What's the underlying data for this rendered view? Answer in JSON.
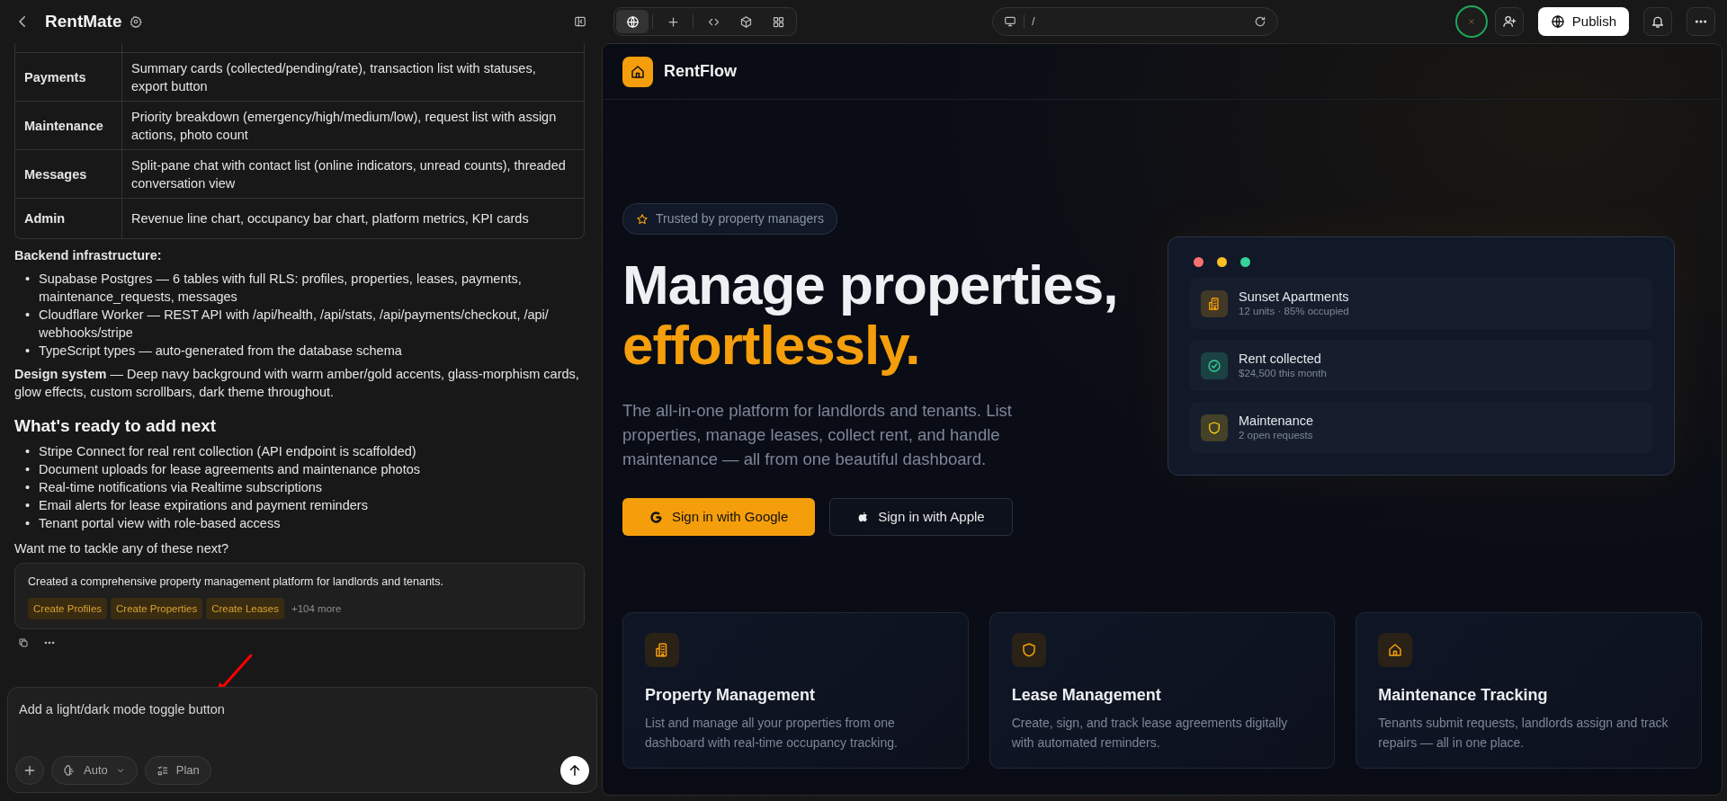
{
  "app": {
    "title": "RentMate"
  },
  "table": {
    "rows": [
      {
        "page": "Payments",
        "description": "Summary cards (collected/pending/rate), transaction list with statuses, export button"
      },
      {
        "page": "Maintenance",
        "description": "Priority breakdown (emergency/high/medium/low), request list with assign actions, photo count"
      },
      {
        "page": "Messages",
        "description": "Split-pane chat with contact list (online indicators, unread counts), threaded conversation view"
      },
      {
        "page": "Admin",
        "description": "Revenue line chart, occupancy bar chart, platform metrics, KPI cards"
      }
    ]
  },
  "bullet": "•",
  "backend": {
    "heading": "Backend infrastructure:",
    "items": [
      "Supabase Postgres — 6 tables with full RLS: profiles, properties, leases, payments, maintenance_requests, messages",
      "Cloudflare Worker — REST API with /api/health, /api/stats, /api/payments/checkout, /api/ webhooks/stripe",
      "TypeScript types — auto-generated from the database schema"
    ]
  },
  "design_system": "**Design system** — Deep navy background with warm amber/gold accents, glass-morphism cards, glow effects, custom scrollbars, dark theme throughout.",
  "next": {
    "heading": "What's ready to add next",
    "items": [
      "Stripe Connect for real rent collection (API endpoint is scaffolded)",
      "Document uploads for lease agreements and maintenance photos",
      "Real-time notifications via Realtime subscriptions",
      "Email alerts for lease expirations and payment reminders",
      "Tenant portal view with role-based access"
    ]
  },
  "question": "Want me to tackle any of these next?",
  "summary": {
    "text": "Created a comprehensive property management platform for landlords and tenants.",
    "tags": [
      "Create Profiles",
      "Create Properties",
      "Create Leases"
    ],
    "more": "+104 more"
  },
  "composer": {
    "value": "Add a light/dark mode toggle button",
    "mode": "Auto",
    "plan": "Plan"
  },
  "toolbar": {
    "tabs": [
      {
        "kind": "globe",
        "selected": true
      },
      {
        "kind": "plus",
        "selected": false
      },
      {
        "kind": "code",
        "selected": false
      },
      {
        "kind": "cube",
        "selected": false
      },
      {
        "kind": "grid",
        "selected": false
      }
    ]
  },
  "address": {
    "path": "/"
  },
  "publish": "Publish",
  "preview": {
    "brand": "RentFlow",
    "badge": "Trusted by property managers",
    "headline": "Manage properties,",
    "headline_accent": "effortlessly.",
    "lead": "The all-in-one platform for landlords and tenants. List properties, manage leases, collect rent, and handle maintenance — all from one beautiful dashboard.",
    "buttons": [
      {
        "label": "Sign in with Google",
        "kind": "google"
      },
      {
        "label": "Sign in with Apple",
        "kind": "apple"
      }
    ],
    "stats": [
      {
        "title": "Sunset Apartments",
        "subtitle": "12 units · 85% occupied",
        "kind": "building",
        "color": "#f59e0b"
      },
      {
        "title": "Rent collected",
        "subtitle": "$24,500 this month",
        "kind": "check",
        "color": "#34d399"
      },
      {
        "title": "Maintenance",
        "subtitle": "2 open requests",
        "kind": "shield",
        "color": "#facc15"
      }
    ],
    "features": [
      {
        "title": "Property Management",
        "text": "List and manage all your properties from one dashboard with real-time occupancy tracking.",
        "kind": "building"
      },
      {
        "title": "Lease Management",
        "text": "Create, sign, and track lease agreements digitally with automated reminders.",
        "kind": "shield"
      },
      {
        "title": "Maintenance Tracking",
        "text": "Tenants submit requests, landlords assign and track repairs — all in one place.",
        "kind": "home"
      }
    ]
  }
}
